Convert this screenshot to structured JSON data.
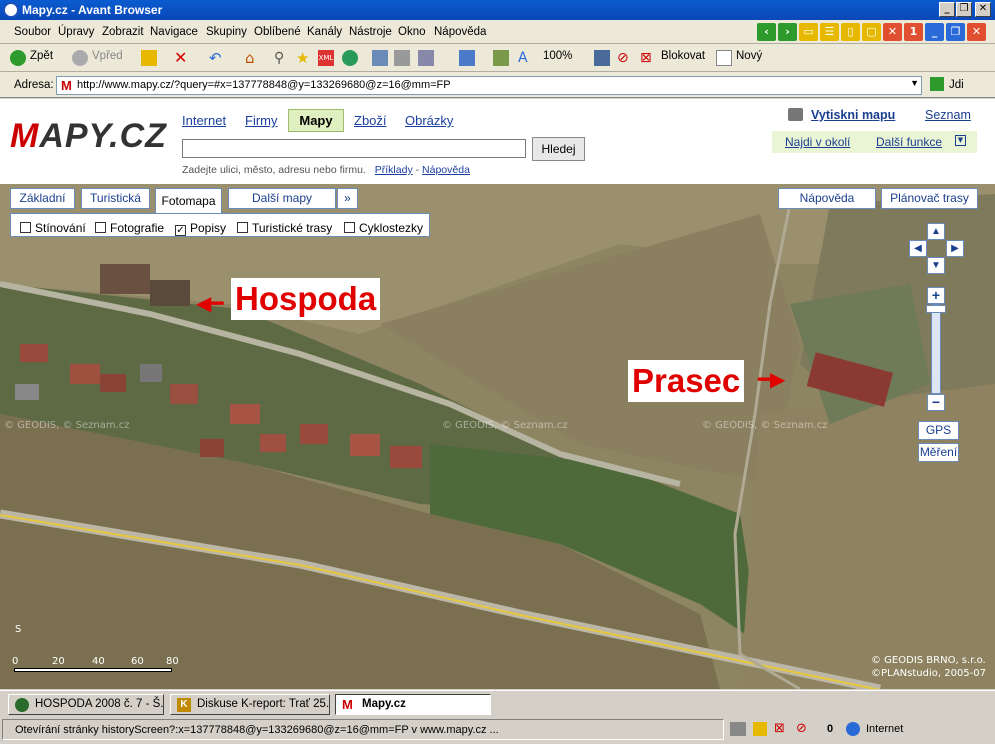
{
  "window": {
    "title": "Mapy.cz - Avant Browser"
  },
  "menubar": {
    "items": [
      "Soubor",
      "Úpravy",
      "Zobrazit",
      "Navigace",
      "Skupiny",
      "Oblíbené",
      "Kanály",
      "Nástroje",
      "Okno",
      "Nápověda"
    ]
  },
  "toolbar": {
    "back": "Zpět",
    "forward": "Vpřed",
    "zoom": "100%",
    "block": "Blokovat",
    "new": "Nový"
  },
  "address": {
    "label": "Adresa:",
    "url": "http://www.mapy.cz/?query=#x=137778848@y=133269680@z=16@mm=FP",
    "go": "Jdi"
  },
  "site": {
    "logo": "MAPY.CZ",
    "nav": [
      "Internet",
      "Firmy",
      "Mapy",
      "Zboží",
      "Obrázky"
    ],
    "search_button": "Hledej",
    "hint": "Zadejte ulici, město, adresu nebo firmu.",
    "hint_links": [
      "Příklady",
      "Nápověda"
    ],
    "print": "Vytiskni mapu",
    "seznam": "Seznam",
    "nearby": "Najdi v okolí",
    "more_functions": "Další funkce"
  },
  "map": {
    "tabs": [
      "Základní",
      "Turistická",
      "Fotomapa",
      "Další mapy"
    ],
    "help": "Nápověda",
    "route": "Plánovač trasy",
    "layers": [
      {
        "label": "Stínování",
        "checked": false
      },
      {
        "label": "Fotografie",
        "checked": false
      },
      {
        "label": "Popisy",
        "checked": true
      },
      {
        "label": "Turistické trasy",
        "checked": false
      },
      {
        "label": "Cyklostezky",
        "checked": false
      }
    ],
    "gps": "GPS",
    "measure": "Měření",
    "annotations": [
      "Hospoda",
      "Prasec"
    ],
    "watermark": "© GEODIS, © Seznam.cz",
    "scale_ticks": [
      "0",
      "20",
      "40",
      "60",
      "80"
    ],
    "north": "S",
    "copyright": [
      "© GEODIS BRNO, s.r.o.",
      "©PLANstudio, 2005-07"
    ]
  },
  "taskbar": {
    "tabs": [
      "HOSPODA 2008 č. 7 - Š...",
      "Diskuse K-report: Trať 25...",
      "Mapy.cz"
    ]
  },
  "status": {
    "text": "Otevírání stránky historyScreen?:x=137778848@y=133269680@z=16@mm=FP v www.mapy.cz ...",
    "count": "0",
    "zone": "Internet"
  }
}
